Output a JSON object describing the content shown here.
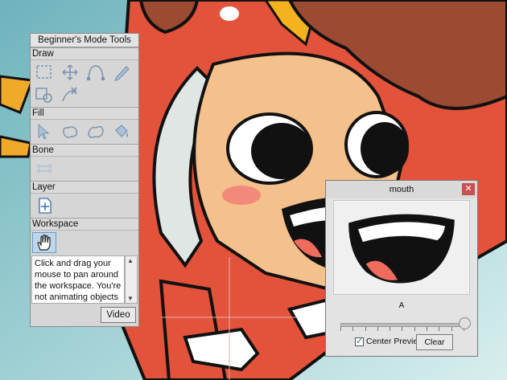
{
  "tools_panel": {
    "title": "Beginner's Mode Tools",
    "sections": {
      "draw": "Draw",
      "fill": "Fill",
      "bone": "Bone",
      "layer": "Layer",
      "workspace": "Workspace"
    },
    "description": "Click and drag your mouse to pan around the workspace. You're not animating objects",
    "video_label": "Video"
  },
  "switch_window": {
    "title": "mouth",
    "frame_label": "A",
    "center_preview_label": "Center Preview",
    "center_preview_checked": true,
    "clear_label": "Clear",
    "slider_position": 1.0
  },
  "colors": {
    "sky": "#7fb9c2",
    "hood": "#e3523a",
    "skin": "#f4c08c",
    "selection": "#bcd6ee"
  }
}
